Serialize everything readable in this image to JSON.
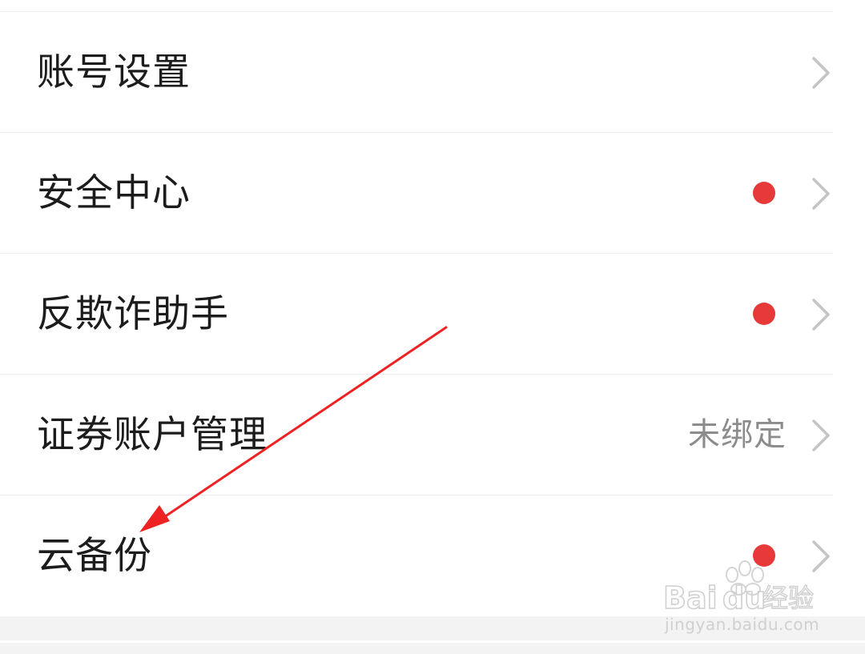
{
  "menu": {
    "items": [
      {
        "label": "账号设置",
        "status": "",
        "has_dot": false
      },
      {
        "label": "安全中心",
        "status": "",
        "has_dot": true
      },
      {
        "label": "反欺诈助手",
        "status": "",
        "has_dot": true
      },
      {
        "label": "证券账户管理",
        "status": "未绑定",
        "has_dot": false
      },
      {
        "label": "云备份",
        "status": "",
        "has_dot": true
      }
    ]
  },
  "icons": {
    "chevron": "chevron-right-icon",
    "dot": "red-dot-badge"
  },
  "colors": {
    "dot": "#e8393a",
    "label": "#1c1c1c",
    "status": "#8c8c8c",
    "chevron": "#c4c4c4",
    "annotation_arrow": "#ee2222"
  },
  "watermark": {
    "brand": "Baidu经验",
    "url": "jingyan.baidu.com"
  }
}
